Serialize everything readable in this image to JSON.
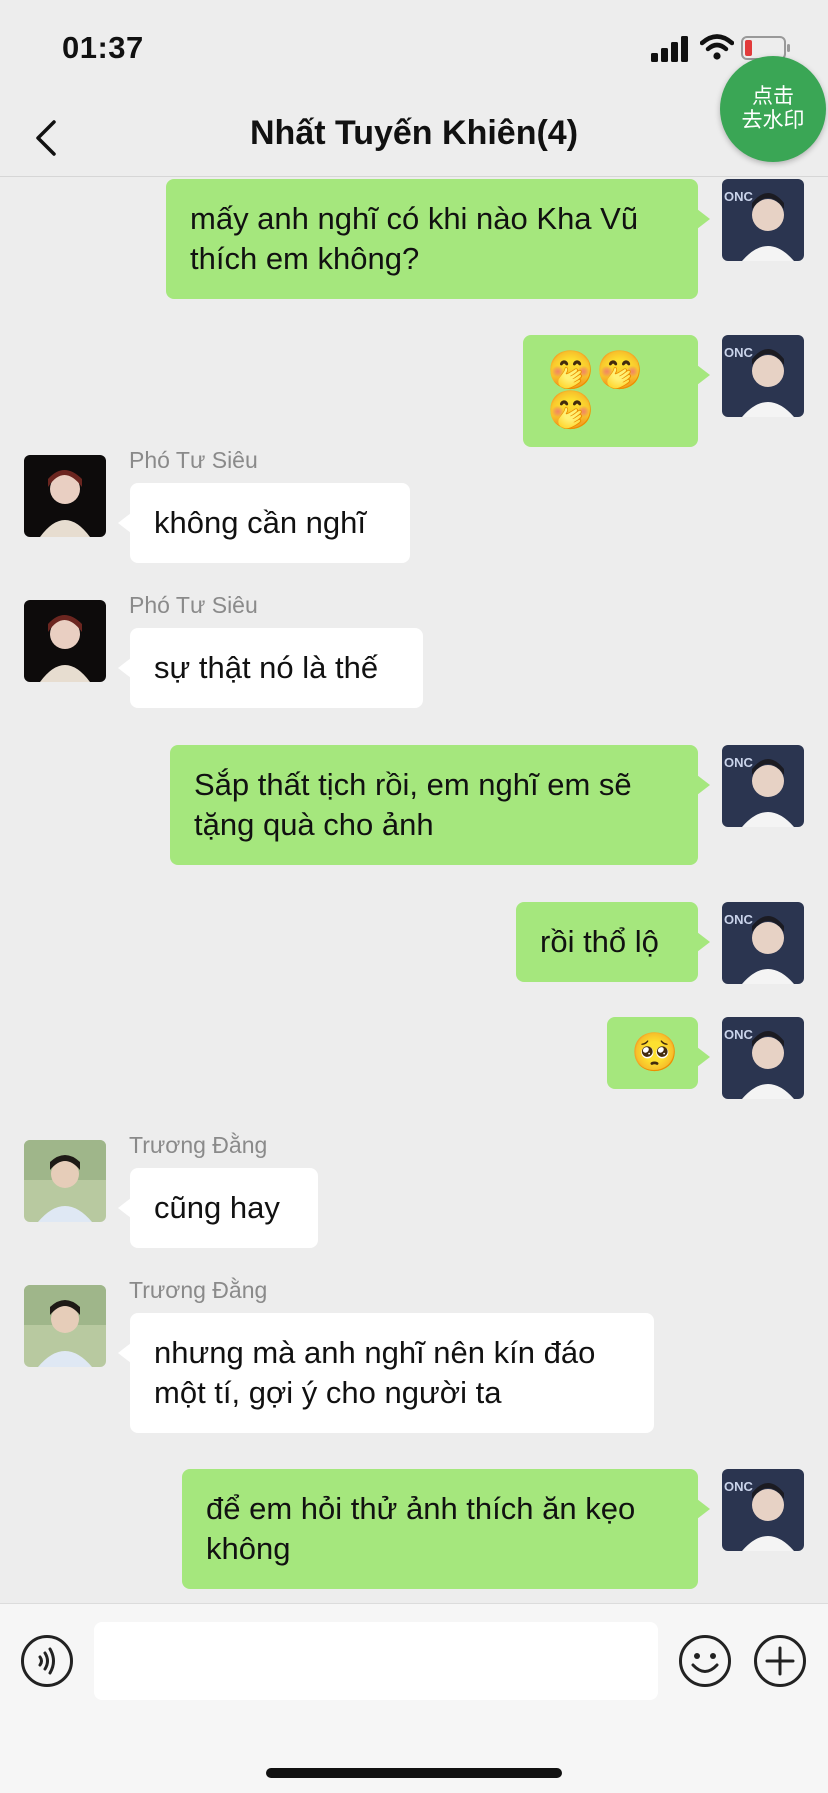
{
  "status": {
    "time": "01:37"
  },
  "nav": {
    "title": "Nhất Tuyến Khiên(4)",
    "watermark_badge": "点击\n去水印"
  },
  "messages": [
    {
      "side": "out",
      "text": "mấy anh nghĩ có khi nào Kha Vũ thích em không?"
    },
    {
      "side": "out",
      "text": "🤭🤭🤭"
    },
    {
      "side": "in",
      "sender": "Phó Tư Siêu",
      "text": "không cần nghĩ"
    },
    {
      "side": "in",
      "sender": "Phó Tư Siêu",
      "text": "sự thật nó là thế"
    },
    {
      "side": "out",
      "text": "Sắp thất tịch rồi, em nghĩ em sẽ tặng quà cho ảnh"
    },
    {
      "side": "out",
      "text": "rồi thổ lộ"
    },
    {
      "side": "out",
      "text": "🥺"
    },
    {
      "side": "in",
      "sender": "Trương Đằng",
      "text": "cũng hay"
    },
    {
      "side": "in",
      "sender": "Trương Đằng",
      "text": "nhưng mà anh nghĩ nên kín đáo một tí, gợi ý cho người ta"
    },
    {
      "side": "out",
      "text": "để em hỏi thử ảnh thích ăn kẹo không"
    }
  ],
  "input": {
    "value": "",
    "placeholder": ""
  },
  "icons": {
    "back": "chevron-left-icon",
    "voice": "voice-icon",
    "emoji": "smiley-icon",
    "plus": "plus-icon"
  },
  "colors": {
    "bubble_out": "#a5e77d",
    "bubble_in": "#ffffff",
    "background": "#ededed",
    "badge": "#3aa655"
  }
}
